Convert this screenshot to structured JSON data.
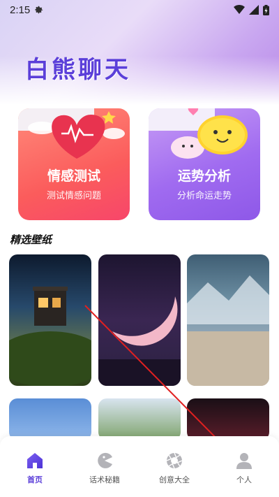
{
  "status_bar": {
    "time": "2:15"
  },
  "app_title": "白熊聊天",
  "cards": [
    {
      "title": "情感测试",
      "subtitle": "测试情感问题"
    },
    {
      "title": "运势分析",
      "subtitle": "分析命运走势"
    }
  ],
  "section_title": "精选壁纸",
  "bottom_nav": [
    {
      "label": "首页",
      "icon": "home-icon",
      "active": true
    },
    {
      "label": "话术秘籍",
      "icon": "pacman-icon",
      "active": false
    },
    {
      "label": "创意大全",
      "icon": "aperture-icon",
      "active": false
    },
    {
      "label": "个人",
      "icon": "person-icon",
      "active": false
    }
  ],
  "colors": {
    "accent": "#5b3fd9",
    "annotation_arrow": "#e02020"
  }
}
